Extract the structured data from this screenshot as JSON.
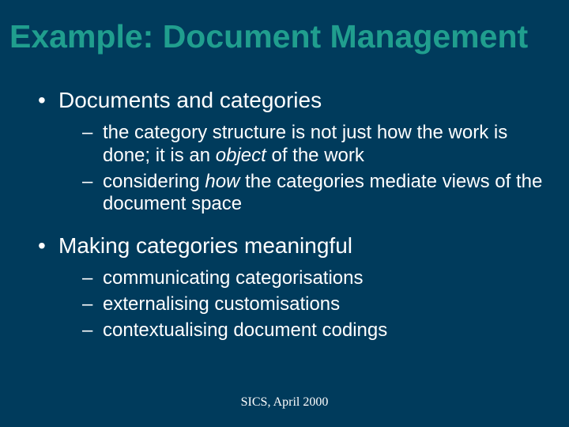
{
  "title": "Example: Document Management",
  "b1": "Documents and categories",
  "b1s1a": "the category structure is not just how the work is done; it is an ",
  "b1s1b": "object",
  "b1s1c": " of the work",
  "b1s2a": "considering ",
  "b1s2b": "how",
  "b1s2c": " the categories mediate views of the document space",
  "b2": "Making categories meaningful",
  "b2s1": "communicating categorisations",
  "b2s2": "externalising customisations",
  "b2s3": "contextualising document codings",
  "footer": "SICS, April 2000"
}
